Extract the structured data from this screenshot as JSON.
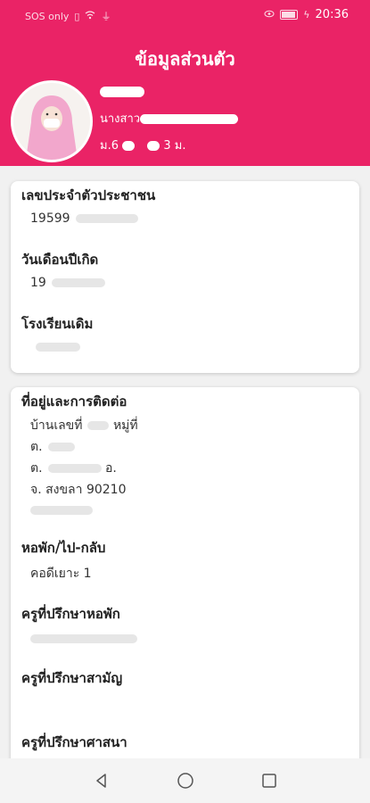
{
  "status_bar": {
    "carrier": "SOS only",
    "time": "20:36"
  },
  "header": {
    "title": "ข้อมูลส่วนตัว",
    "profile": {
      "prefix": "นางสาว",
      "class_prefix": "ม.6",
      "class_suffix": "3 ม."
    }
  },
  "personal_card": {
    "id_label": "เลขประจำตัวประชาชน",
    "id_value": "19599",
    "birth_label": "วันเดือนปีเกิด",
    "birth_value": "19",
    "school_label": "โรงเรียนเดิม",
    "school_value": ""
  },
  "contact_card": {
    "address_label": "ที่อยู่และการติดต่อ",
    "address_house": "บ้านเลขที่",
    "address_moo": "หมู่ที่",
    "address_line2": "ต.",
    "address_line3": "ต.",
    "address_line3_amphoe": "อ.",
    "address_line4": "จ. สงขลา 90210",
    "dorm_label": "หอพัก/ไป-กลับ",
    "dorm_value": "คอดีเยาะ 1",
    "dorm_advisor_label": "ครูที่ปรึกษาหอพัก",
    "academic_advisor_label": "ครูที่ปรึกษาสามัญ",
    "religion_advisor_label": "ครูที่ปรึกษาศาสนา"
  },
  "icons": [
    "back-icon",
    "home-icon",
    "recents-icon",
    "wifi-icon",
    "usb-icon",
    "battery-icon",
    "eye-icon"
  ]
}
